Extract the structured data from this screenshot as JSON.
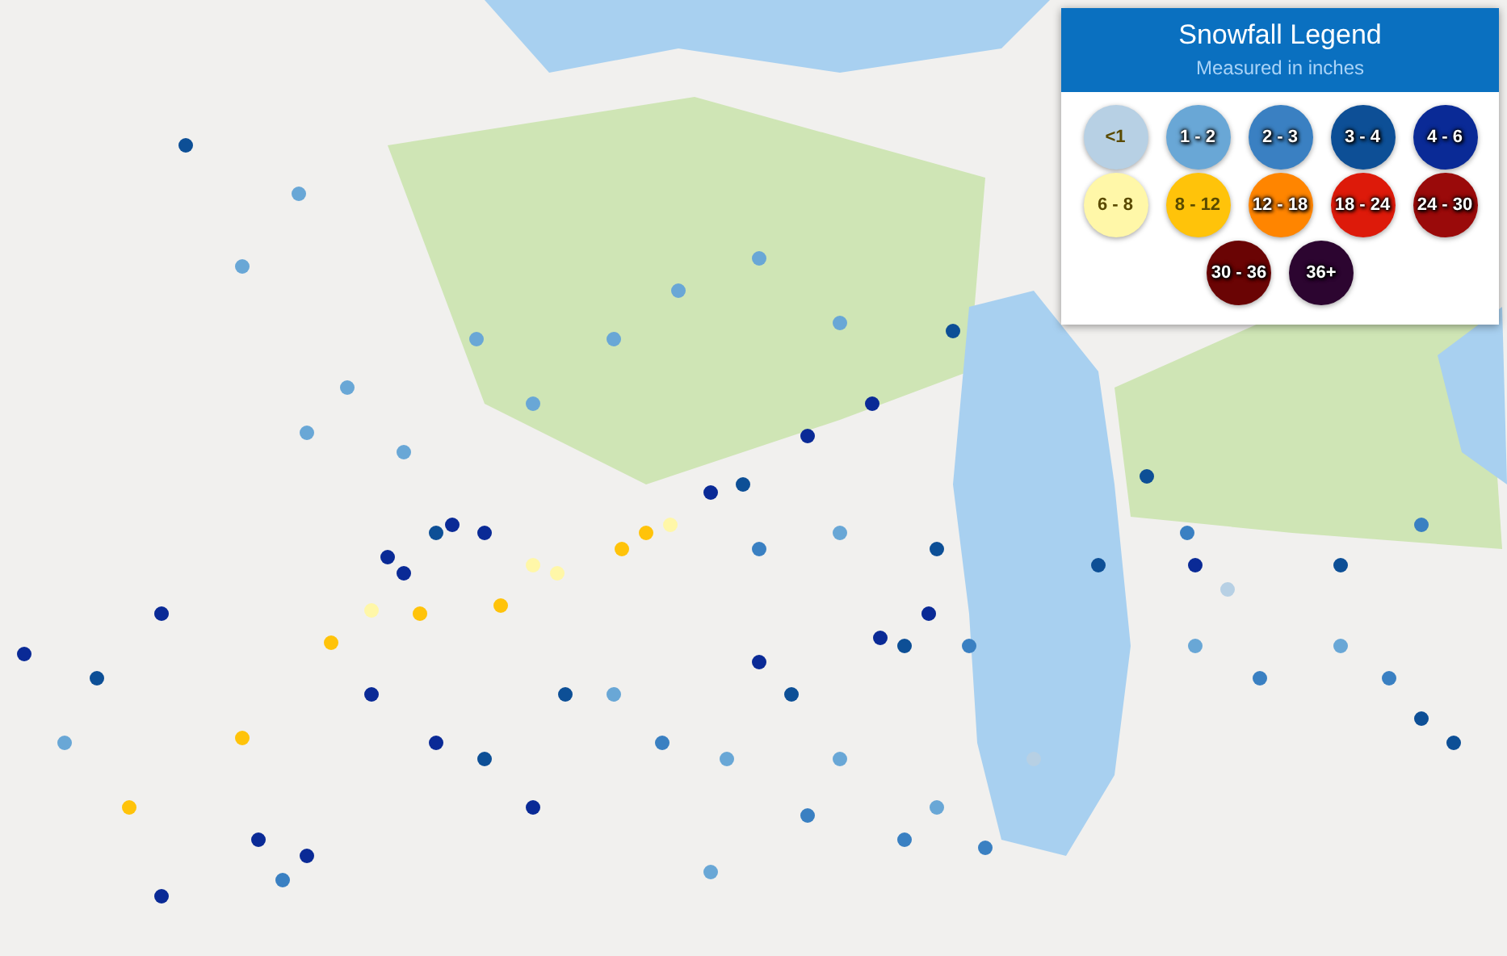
{
  "legend": {
    "title": "Snowfall Legend",
    "subtitle": "Measured in inches",
    "items": [
      {
        "label": "<1",
        "color": "#b7d0e4"
      },
      {
        "label": "1 - 2",
        "color": "#69a7d6"
      },
      {
        "label": "2 - 3",
        "color": "#3a80c2"
      },
      {
        "label": "3 - 4",
        "color": "#0d4f96"
      },
      {
        "label": "4 - 6",
        "color": "#0a2a96"
      },
      {
        "label": "6 - 8",
        "color": "#fff7a8"
      },
      {
        "label": "8 - 12",
        "color": "#ffc30a"
      },
      {
        "label": "12 - 18",
        "color": "#ff8500"
      },
      {
        "label": "18 - 24",
        "color": "#dd1a0a"
      },
      {
        "label": "24 - 30",
        "color": "#9a0a0a"
      },
      {
        "label": "30 - 36",
        "color": "#6a0404"
      },
      {
        "label": "36+",
        "color": "#2c0530"
      }
    ]
  }
}
